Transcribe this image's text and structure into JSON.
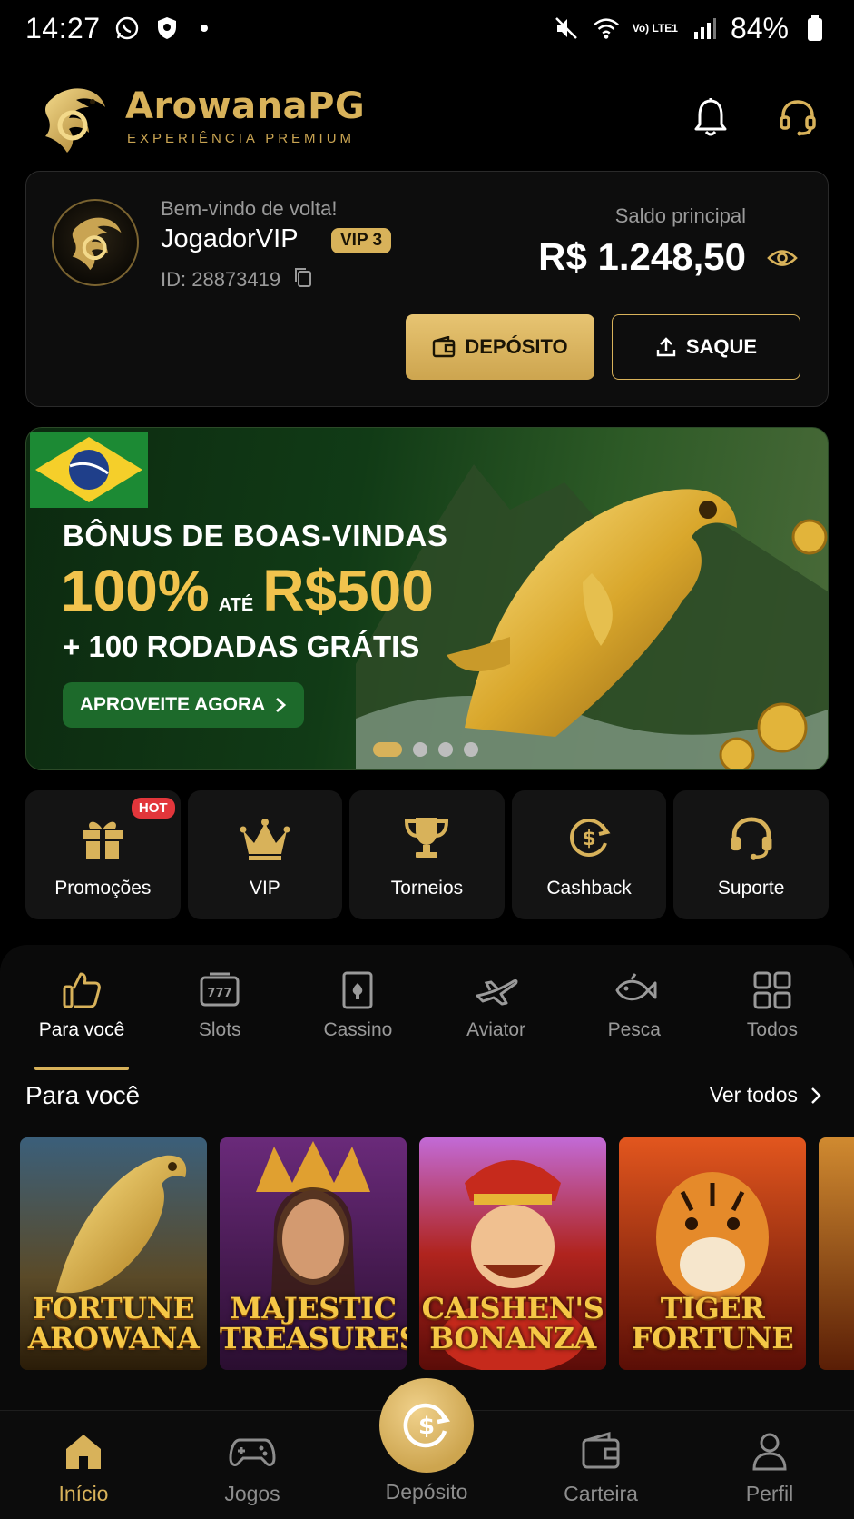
{
  "status_bar": {
    "time": "14:27",
    "battery": "84%",
    "network_label": "Vo) LTE1"
  },
  "header": {
    "brand": "ArowanaPG",
    "tagline": "EXPERIÊNCIA PREMIUM"
  },
  "account": {
    "welcome": "Bem-vindo de volta!",
    "username": "JogadorVIP",
    "vip_level": "VIP 3",
    "user_id": "ID: 28873419",
    "balance_label": "Saldo principal",
    "balance": "R$ 1.248,50",
    "deposit_label": "DEPÓSITO",
    "withdraw_label": "SAQUE"
  },
  "banner": {
    "title": "BÔNUS DE BOAS-VINDAS",
    "percent": "100%",
    "until": "ATÉ",
    "amount": "R$500",
    "subtitle": "+ 100 RODADAS GRÁTIS",
    "cta": "APROVEITE AGORA",
    "slides": 4,
    "active_slide": 1
  },
  "quick_actions": [
    {
      "label": "Promoções",
      "icon": "gift-icon",
      "badge": "HOT"
    },
    {
      "label": "VIP",
      "icon": "crown-icon"
    },
    {
      "label": "Torneios",
      "icon": "trophy-icon"
    },
    {
      "label": "Cashback",
      "icon": "cashback-icon"
    },
    {
      "label": "Suporte",
      "icon": "headset-icon"
    }
  ],
  "categories": [
    {
      "label": "Para você",
      "icon": "thumbs-up-icon",
      "active": true
    },
    {
      "label": "Slots",
      "icon": "slot-machine-icon"
    },
    {
      "label": "Cassino",
      "icon": "card-icon"
    },
    {
      "label": "Aviator",
      "icon": "plane-icon"
    },
    {
      "label": "Pesca",
      "icon": "fish-icon"
    },
    {
      "label": "Todos",
      "icon": "grid-icon"
    }
  ],
  "section": {
    "title": "Para você",
    "see_all": "Ver todos"
  },
  "games": [
    {
      "line1": "FORTUNE",
      "line2": "AROWANA"
    },
    {
      "line1": "MAJESTIC",
      "line2": "TREASURES"
    },
    {
      "line1": "CAISHEN'S",
      "line2": "BONANZA"
    },
    {
      "line1": "TIGER",
      "line2": "FORTUNE"
    }
  ],
  "bottom_nav": [
    {
      "label": "Início",
      "icon": "home-icon",
      "active": true
    },
    {
      "label": "Jogos",
      "icon": "gamepad-icon"
    },
    {
      "label": "Depósito",
      "icon": "deposit-coin-icon"
    },
    {
      "label": "Carteira",
      "icon": "wallet-icon"
    },
    {
      "label": "Perfil",
      "icon": "user-icon"
    }
  ],
  "colors": {
    "gold": "#d8b25a",
    "background": "#000000",
    "card": "#141414",
    "hot": "#e2363b",
    "cta_green": "#1d6a2b"
  }
}
